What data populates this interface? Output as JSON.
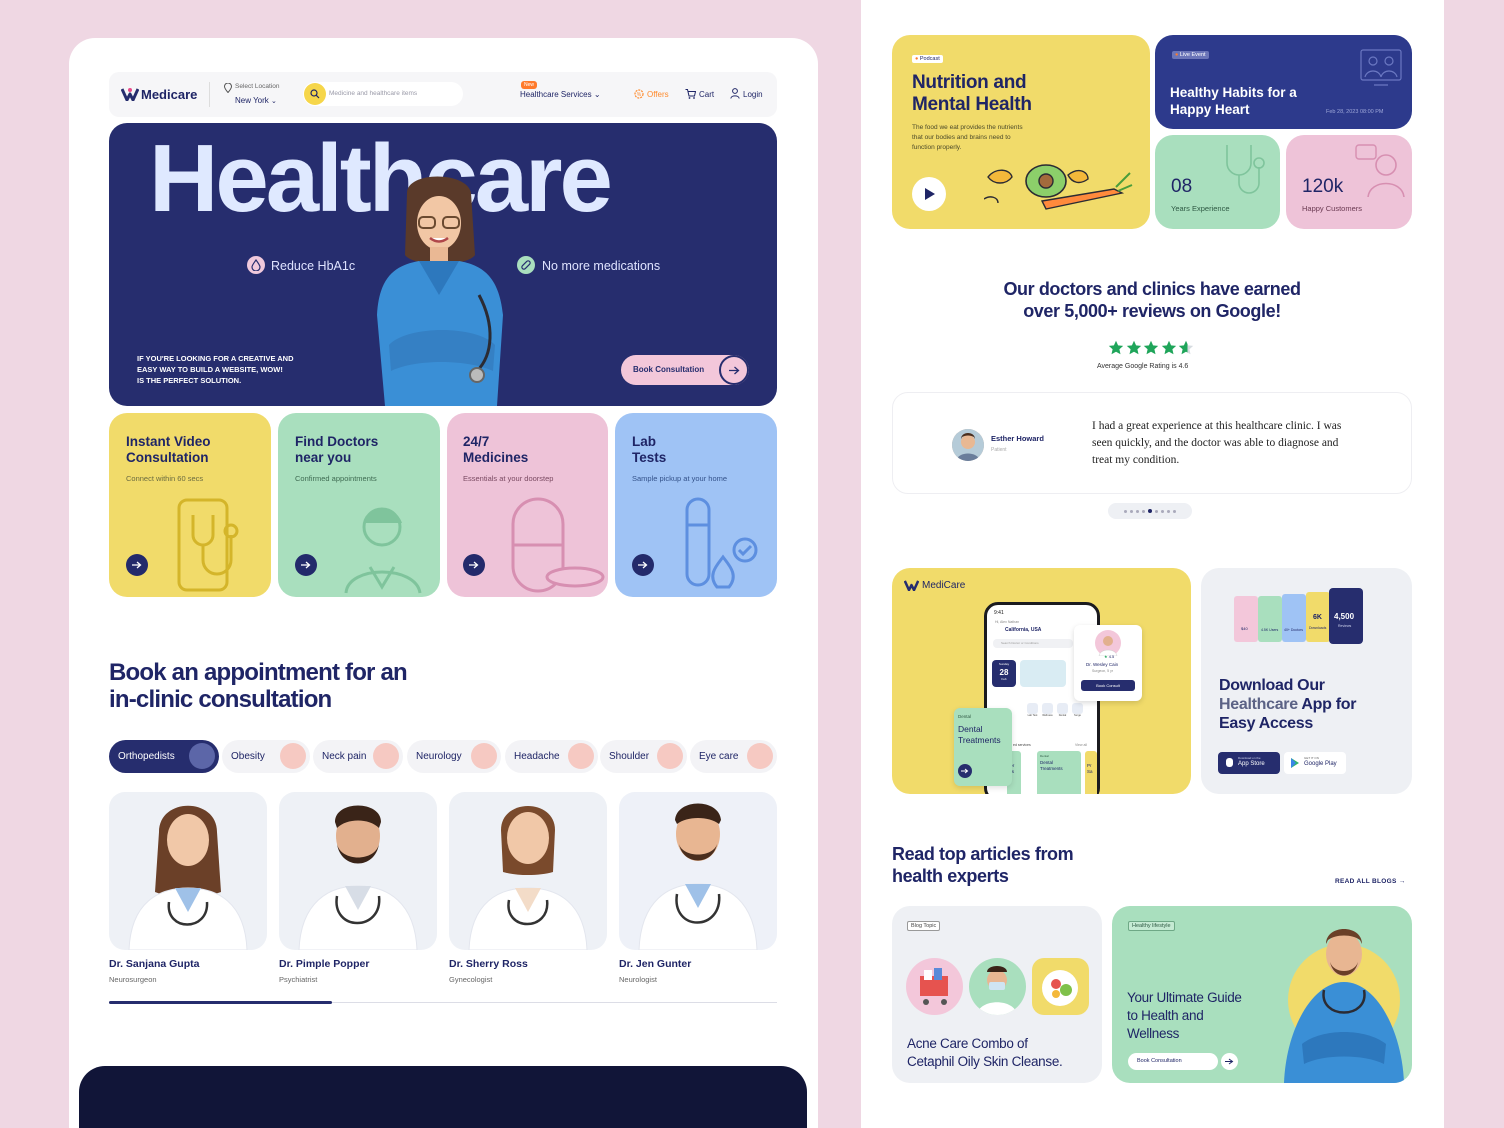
{
  "nav": {
    "brand": "Medicare",
    "location_label": "Select Location",
    "location_value": "New York",
    "search_placeholder": "Medicine and healthcare items",
    "new_badge": "New",
    "services": "Healthcare Services",
    "offers": "Offers",
    "cart": "Cart",
    "login": "Login"
  },
  "hero": {
    "title": "Healthcare",
    "tag1": "Reduce HbA1c",
    "tag2": "No more medications",
    "subtext": [
      "IF YOU'RE LOOKING FOR A CREATIVE AND",
      "EASY WAY TO BUILD A WEBSITE, WOW!",
      "IS THE PERFECT SOLUTION."
    ],
    "cta": "Book Consultation"
  },
  "services": [
    {
      "title1": "Instant Video",
      "title2": "Consultation",
      "sub": "Connect within 60 secs",
      "color": "#f1db6a"
    },
    {
      "title1": "Find Doctors",
      "title2": "near you",
      "sub": "Confirmed appointments",
      "color": "#a9dfbe"
    },
    {
      "title1": "24/7",
      "title2": "Medicines",
      "sub": "Essentials at your doorstep",
      "color": "#eec3d8"
    },
    {
      "title1": "Lab",
      "title2": "Tests",
      "sub": "Sample pickup at your home",
      "color": "#9fc3f5"
    }
  ],
  "appointment": {
    "heading1": "Book an appointment for an",
    "heading2": "in-clinic consultation",
    "filters": [
      "Orthopedists",
      "Obesity",
      "Neck pain",
      "Neurology",
      "Headache",
      "Shoulder",
      "Eye care"
    ],
    "doctors": [
      {
        "name": "Dr. Sanjana Gupta",
        "role": "Neurosurgeon"
      },
      {
        "name": "Dr. Pimple Popper",
        "role": "Psychiatrist"
      },
      {
        "name": "Dr. Sherry Ross",
        "role": "Gynecologist"
      },
      {
        "name": "Dr. Jen Gunter",
        "role": "Neurologist"
      }
    ]
  },
  "podcast": {
    "badge": "Podcast",
    "title1": "Nutrition and",
    "title2": "Mental Health",
    "desc": [
      "The food we eat provides the nutrients",
      "that our bodies and brains need to",
      "function properly."
    ]
  },
  "live": {
    "badge": "Live Event",
    "title1": "Healthy Habits for a",
    "title2": "Happy Heart",
    "date": "Feb 28, 2023 08:00 PM"
  },
  "stats": [
    {
      "value": "08",
      "label": "Years Experience"
    },
    {
      "value": "120k",
      "label": "Happy Customers"
    }
  ],
  "reviews": {
    "heading1": "Our doctors and clinics have earned",
    "heading2": "over 5,000+ reviews on Google!",
    "rating_text": "Average Google Rating is 4.6",
    "rating": 4.6,
    "reviewer": "Esther Howard",
    "reviewer_role": "Patient",
    "quote": [
      "I had a great experience at this healthcare clinic. I was",
      "seen quickly, and the doctor was able to diagnose and",
      "treat my condition."
    ]
  },
  "app_promo": {
    "brand": "MediCare",
    "phone_time": "9:41",
    "phone_greet": "Hi, Alex Nathan",
    "phone_location": "California, USA",
    "phone_search": "Search Doctor or Conditions",
    "phone_date_day": "Sunday",
    "phone_date_num": "28",
    "phone_date_mon": "Feb",
    "phone_cats": [
      "Lab Test",
      "Wellness",
      "Dental",
      "Surge"
    ],
    "phone_services": "ed services",
    "phone_viewall": "View all",
    "doc_name": "Dr. Wesley Cain",
    "doc_role": "Surgeon, 5 yr",
    "doc_rating": "4.5",
    "doc_btn": "Book Consult",
    "dental_small": "Dental",
    "dental_title1": "Dental",
    "dental_title2": "Treatments",
    "tile_small": "Dental",
    "tile_title1": "Dental",
    "tile_title2": "Treatments",
    "tile_left": "ver",
    "tile_left2": "tes",
    "tile_right": "Pr",
    "tile_right2": "Sa"
  },
  "download": {
    "title1": "Download Our",
    "title2a": "Healthcare",
    "title2b": " App for",
    "title3": "Easy Access",
    "appstore_small": "Download on the",
    "appstore": "App Store",
    "gplay_small": "GET IT ON",
    "gplay": "Google Play",
    "cards": [
      "$40",
      "4.5K Users",
      "40+ Doctors",
      "6K",
      "Downloads",
      "4,500",
      "Reviews"
    ]
  },
  "articles": {
    "heading1": "Read top articles from",
    "heading2": "health experts",
    "read_all": "READ ALL BLOGS",
    "a1_badge": "Blog Topic",
    "a1_title1": "Acne Care Combo of",
    "a1_title2": "Cetaphil Oily Skin Cleanse.",
    "a2_badge": "Healthy lifestyle",
    "a2_title1": "Your Ultimate Guide",
    "a2_title2": "to Health and",
    "a2_title3": "Wellness",
    "a2_cta": "Book Consultation"
  },
  "colors": {
    "navy": "#262d6e",
    "yellow": "#f1db6a",
    "green": "#a9dfbe",
    "pink": "#eec3d8",
    "blue": "#9fc3f5",
    "star": "#1fa55a",
    "orange": "#ff8a2b"
  }
}
